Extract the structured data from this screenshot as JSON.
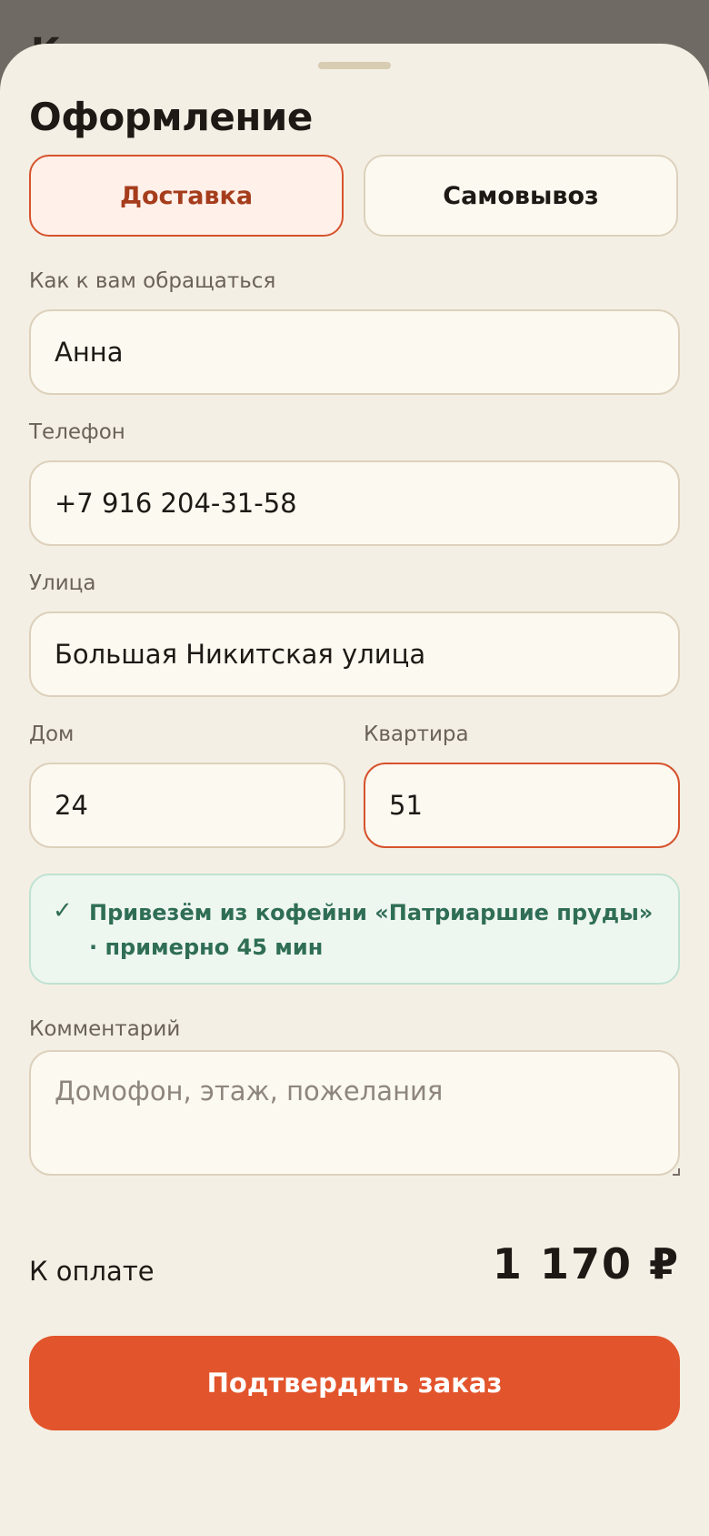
{
  "backdrop": {
    "peek_text": "К"
  },
  "sheet": {
    "title": "Оформление",
    "tabs": [
      {
        "label": "Доставка",
        "active": true
      },
      {
        "label": "Самовывоз",
        "active": false
      }
    ]
  },
  "form": {
    "name": {
      "label": "Как к вам обращаться",
      "value": "Анна"
    },
    "phone": {
      "label": "Телефон",
      "value": "+7 916 204-31-58"
    },
    "street": {
      "label": "Улица",
      "value": "Большая Никитская улица"
    },
    "house": {
      "label": "Дом",
      "value": "24"
    },
    "apartment": {
      "label": "Квартира",
      "value": "51"
    },
    "comment": {
      "label": "Комментарий",
      "value": "",
      "placeholder": "Домофон, этаж, пожелания"
    }
  },
  "notice": {
    "icon": "✓",
    "text": "Привезём из кофейни «Патриаршие пруды» · примерно 45 мин"
  },
  "summary": {
    "total_label": "К оплате",
    "total_value": "1 170 ₽"
  },
  "actions": {
    "confirm_label": "Подтвердить заказ"
  },
  "colors": {
    "accent": "#e2542b",
    "accent_dark": "#a53d1c",
    "sheet_bg": "#f4efe4",
    "field_bg": "#fcf9f1",
    "success": "#2f6e55",
    "backdrop": "#6f6a63"
  }
}
